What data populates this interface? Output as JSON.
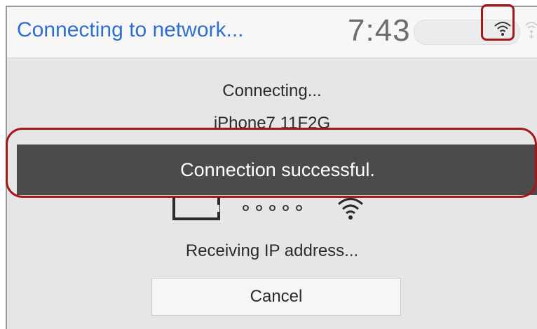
{
  "header": {
    "title": "Connecting to network...",
    "clock": "7:43"
  },
  "status": {
    "line1": "Connecting...",
    "line2": "iPhone7 11F2G",
    "progress": "Receiving IP address..."
  },
  "toast": {
    "message": "Connection successful."
  },
  "cancel_button": {
    "label": "Cancel"
  },
  "icons": {
    "wifi_status": "wifi-icon",
    "device": "tablet-icon",
    "connection": "wifi-icon"
  },
  "colors": {
    "title": "#2f6fd0",
    "highlight": "#a51818",
    "toast_bg": "#4b4b4b"
  }
}
